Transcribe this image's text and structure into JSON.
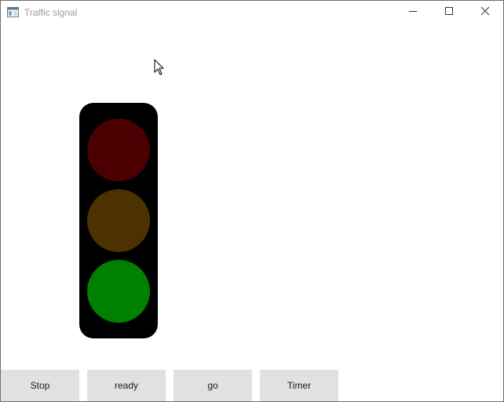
{
  "window": {
    "title": "Traffic signal",
    "controls": {
      "minimize_icon": "minimize-icon",
      "maximize_icon": "maximize-icon",
      "close_icon": "close-icon"
    }
  },
  "signal": {
    "lamps": [
      {
        "name": "red",
        "color": "#4a0000",
        "lit": false
      },
      {
        "name": "amber",
        "color": "#4d3100",
        "lit": false
      },
      {
        "name": "green",
        "color": "#008000",
        "lit": true
      }
    ],
    "housing_color": "#000000"
  },
  "buttons": [
    {
      "label": "Stop"
    },
    {
      "label": "ready"
    },
    {
      "label": "go"
    },
    {
      "label": "Timer"
    }
  ]
}
